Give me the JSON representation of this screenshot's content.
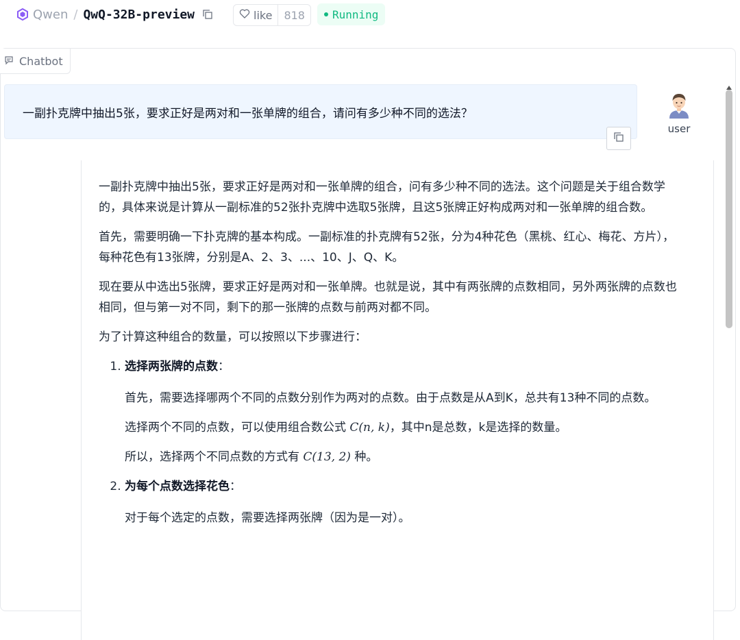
{
  "header": {
    "org": "Qwen",
    "separator": "/",
    "repo": "QwQ-32B-preview",
    "like_label": "like",
    "like_count": "818",
    "status": "Running"
  },
  "colors": {
    "status": "#10b981",
    "user_bubble": "#eff6ff",
    "accent": "#8b5cf6"
  },
  "chatbot": {
    "label": "Chatbot",
    "user": {
      "name": "user",
      "message": "一副扑克牌中抽出5张，要求正好是两对和一张单牌的组合，请问有多少种不同的选法？"
    },
    "bot": {
      "p1": "一副扑克牌中抽出5张，要求正好是两对和一张单牌的组合，问有多少种不同的选法。这个问题是关于组合数学的，具体来说是计算从一副标准的52张扑克牌中选取5张牌，且这5张牌正好构成两对和一张单牌的组合数。",
      "p2": "首先，需要明确一下扑克牌的基本构成。一副标准的扑克牌有52张，分为4种花色（黑桃、红心、梅花、方片），每种花色有13张牌，分别是A、2、3、...、10、J、Q、K。",
      "p3": "现在要从中选出5张牌，要求正好是两对和一张单牌。也就是说，其中有两张牌的点数相同，另外两张牌的点数也相同，但与第一对不同，剩下的那一张牌的点数与前两对都不同。",
      "p4": "为了计算这种组合的数量，可以按照以下步骤进行：",
      "steps": [
        {
          "title": "选择两张牌的点数",
          "colon": "：",
          "s1": "首先，需要选择哪两个不同的点数分别作为两对的点数。由于点数是从A到K，总共有13种不同的点数。",
          "s2_pre": "选择两个不同的点数，可以使用组合数公式 ",
          "s2_math": "C(n, k)",
          "s2_post": "，其中n是总数，k是选择的数量。",
          "s3_pre": "所以，选择两个不同点数的方式有 ",
          "s3_math": "C(13, 2)",
          "s3_post": " 种。"
        },
        {
          "title": "为每个点数选择花色",
          "colon": "：",
          "s1": "对于每个选定的点数，需要选择两张牌（因为是一对）。"
        }
      ]
    }
  }
}
